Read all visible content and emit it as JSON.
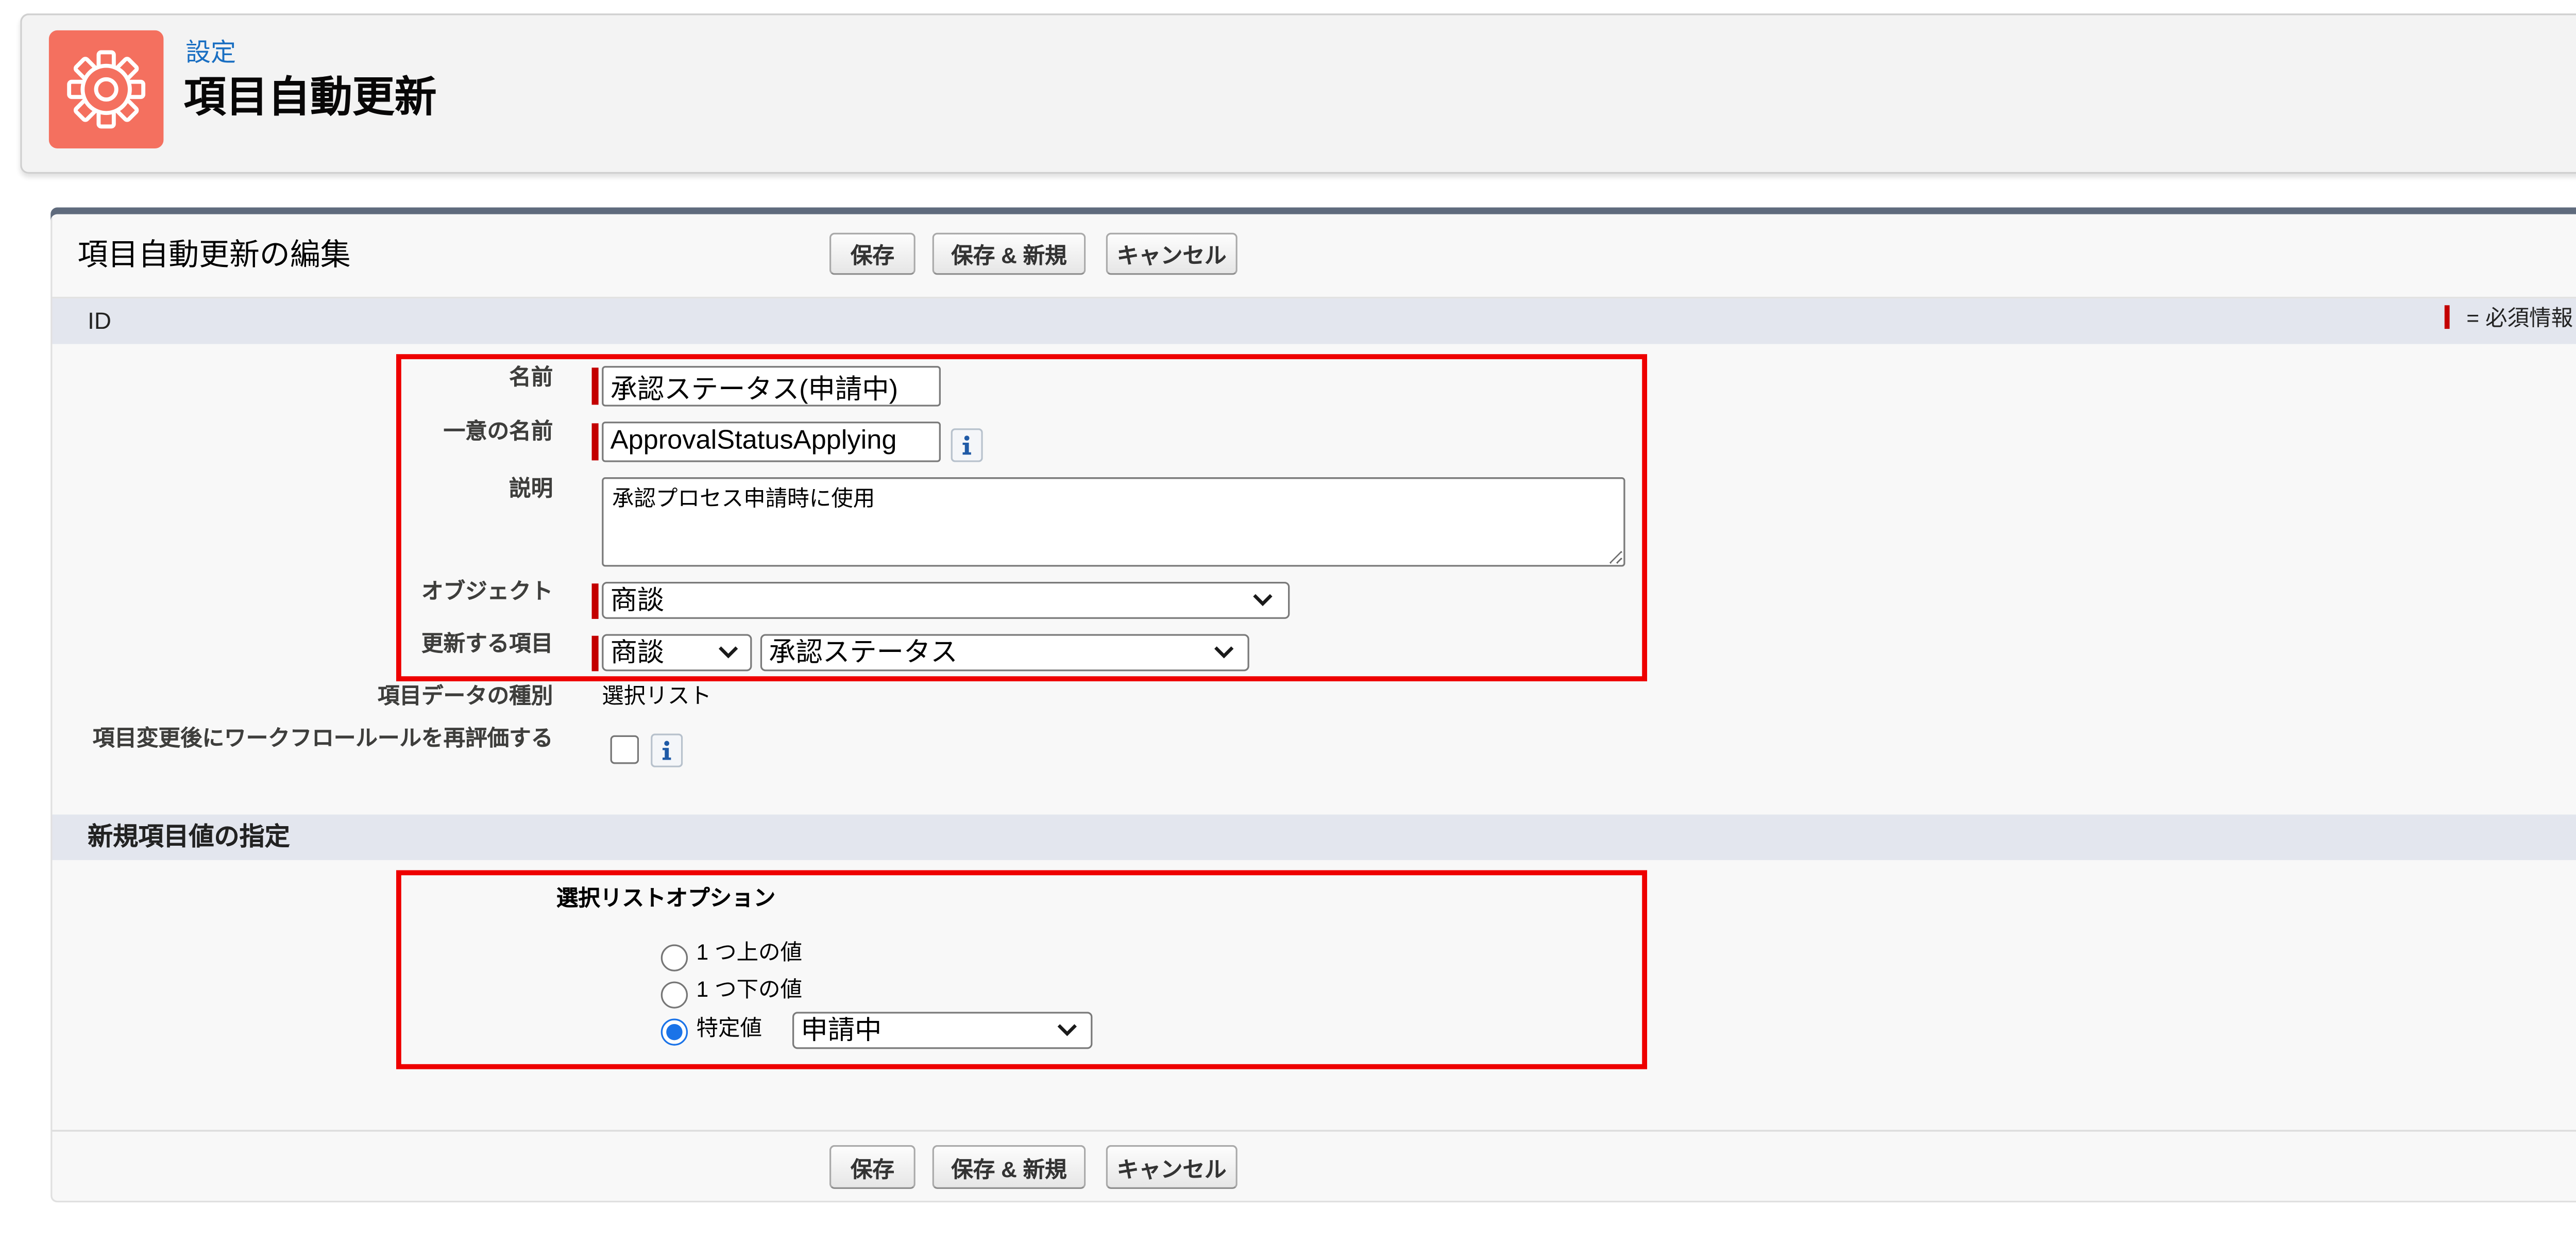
{
  "header": {
    "breadcrumb": "設定",
    "title": "項目自動更新",
    "icon": "gear-icon"
  },
  "edit_panel": {
    "title": "項目自動更新の編集",
    "buttons": {
      "save": "保存",
      "save_new": "保存 & 新規",
      "cancel": "キャンセル"
    },
    "id_section": {
      "title": "ID",
      "required_legend": "= 必須情報"
    },
    "fields": {
      "name": {
        "label": "名前",
        "value": "承認ステータス(申請中)",
        "required": true
      },
      "unique_name": {
        "label": "一意の名前",
        "value": "ApprovalStatusApplying",
        "required": true,
        "help_icon": "info-icon"
      },
      "description": {
        "label": "説明",
        "value": "承認プロセス申請時に使用",
        "required": false
      },
      "object": {
        "label": "オブジェクト",
        "value": "商談",
        "required": true
      },
      "field_to_update": {
        "label": "更新する項目",
        "object_value": "商談",
        "field_value": "承認ステータス",
        "required": true
      },
      "data_type": {
        "label": "項目データの種別",
        "value": "選択リスト"
      },
      "reevaluate": {
        "label": "項目変更後にワークフロールールを再評価する",
        "checked": false,
        "help_icon": "info-icon"
      }
    },
    "new_value_section": {
      "title": "新規項目値の指定",
      "picklist_options_label": "選択リストオプション",
      "options": [
        {
          "label": "1 つ上の値",
          "selected": false
        },
        {
          "label": "1 つ下の値",
          "selected": false
        },
        {
          "label": "特定値",
          "selected": true
        }
      ],
      "specific_value": "申請中"
    }
  },
  "colors": {
    "header_icon_bg": "#f4705f",
    "breadcrumb_link": "#1a6fc2",
    "required_marker": "#c30000",
    "highlight_border": "#ee0000",
    "section_header_bg": "#e3e6ee",
    "panel_top_border": "#5f6b7d",
    "radio_accent": "#1a73e8"
  }
}
